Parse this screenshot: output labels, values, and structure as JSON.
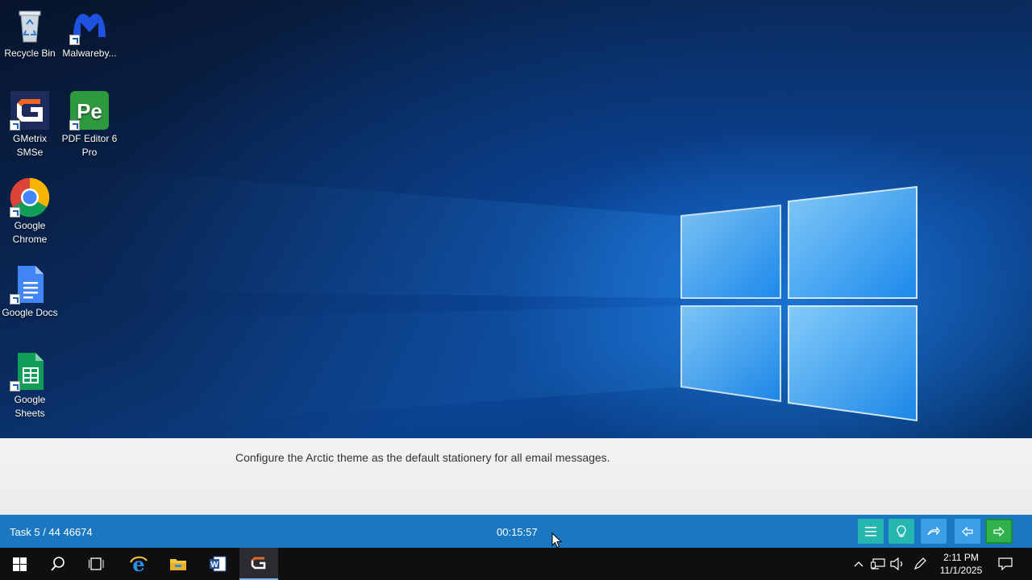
{
  "desktop_icons": [
    {
      "label": "Recycle Bin",
      "icon": "recycle-bin-icon"
    },
    {
      "label": "Malwareby...",
      "icon": "malwarebytes-icon"
    },
    {
      "label": "GMetrix SMSe",
      "icon": "gmetrix-icon"
    },
    {
      "label": "PDF Editor 6 Pro",
      "icon": "pdf-editor-icon"
    },
    {
      "label": "Google Chrome",
      "icon": "chrome-icon"
    },
    {
      "label": "Google Docs",
      "icon": "google-docs-icon"
    },
    {
      "label": "Google Sheets",
      "icon": "google-sheets-icon"
    }
  ],
  "task": {
    "instruction": "Configure the Arctic theme as the default stationery for all email messages."
  },
  "exam_bar": {
    "counter": "Task 5 / 44 46674",
    "timer": "00:15:57",
    "buttons": [
      "menu-icon",
      "lightbulb-icon",
      "skip-icon",
      "previous-icon",
      "next-icon"
    ]
  },
  "taskbar": {
    "apps": [
      "start-icon",
      "search-icon",
      "task-view-icon",
      "edge-icon",
      "file-explorer-icon",
      "word-icon",
      "gmetrix-icon"
    ],
    "clock_time": "2:11 PM",
    "clock_date": "11/1/2025"
  },
  "colors": {
    "exam_bar": "#1a78c2",
    "taskbar": "#0f0f12",
    "next_button": "#2fb24c",
    "teal_button": "#26b6b0"
  }
}
